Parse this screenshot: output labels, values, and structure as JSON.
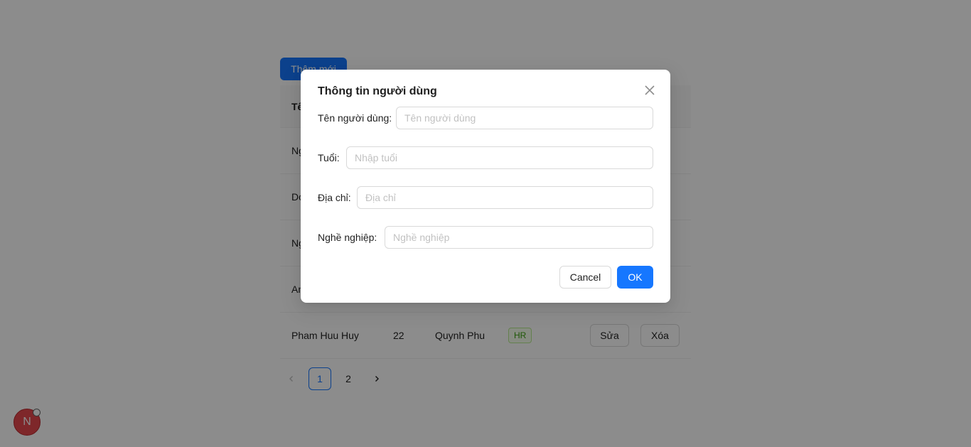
{
  "background": {
    "add_button": "Thêm mới",
    "table": {
      "header_first": "Tên",
      "rows": [
        {
          "name": "Ng",
          "age": "",
          "address": "",
          "job": ""
        },
        {
          "name": "Do",
          "age": "",
          "address": "",
          "job": ""
        },
        {
          "name": "Ng",
          "age": "",
          "address": "",
          "job": ""
        },
        {
          "name": "An",
          "age": "",
          "address": "",
          "job": ""
        },
        {
          "name": "Pham Huu Huy",
          "age": "22",
          "address": "Quynh Phu",
          "job": "HR"
        }
      ],
      "edit_label": "Sửa",
      "delete_label": "Xóa"
    },
    "pagination": {
      "prev": "‹",
      "pages": [
        "1",
        "2"
      ],
      "current": "1",
      "next": "›"
    },
    "avatar_letter": "N"
  },
  "modal": {
    "title": "Thông tin người dùng",
    "fields": [
      {
        "label": "Tên người dùng",
        "placeholder": "Tên người dùng",
        "value": ""
      },
      {
        "label": "Tuổi",
        "placeholder": "Nhập tuổi",
        "value": ""
      },
      {
        "label": "Địa chỉ",
        "placeholder": "Địa chỉ",
        "value": ""
      },
      {
        "label": "Nghề nghiệp",
        "placeholder": "Nghề nghiệp",
        "value": ""
      }
    ],
    "cancel_label": "Cancel",
    "ok_label": "OK"
  },
  "colors": {
    "primary": "#1677ff",
    "tag_green": "#389e0d",
    "avatar_red": "#e5484d"
  }
}
